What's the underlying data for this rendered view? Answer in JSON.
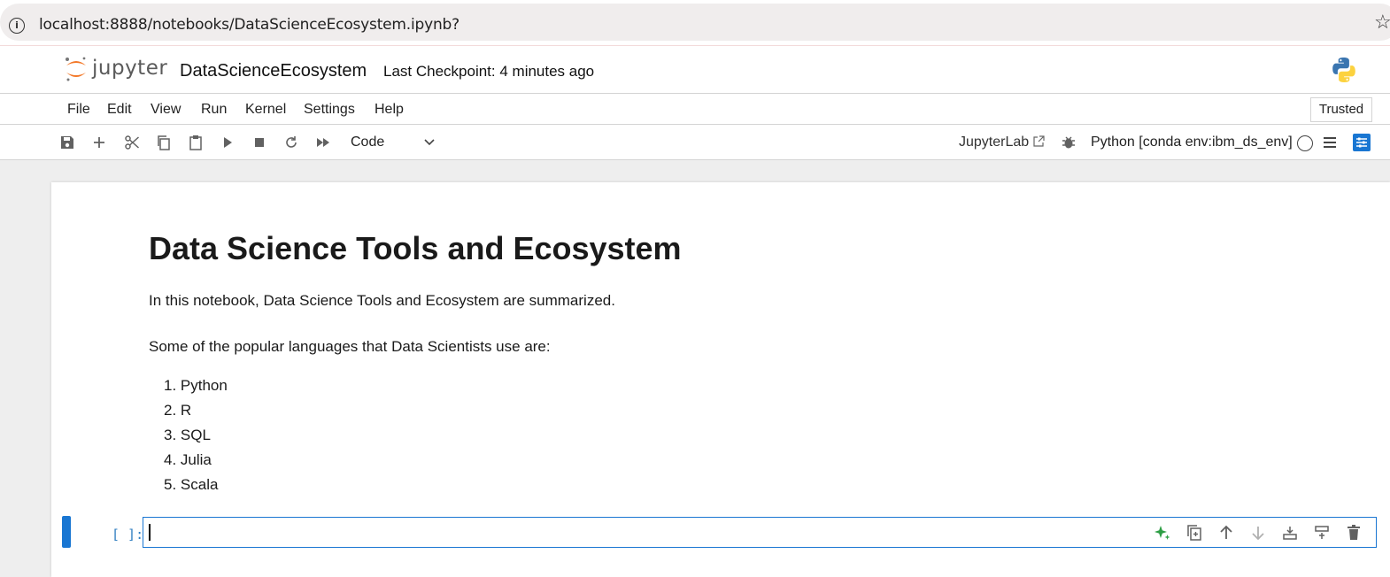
{
  "browser": {
    "url": "localhost:8888/notebooks/DataScienceEcosystem.ipynb?"
  },
  "header": {
    "logo_text": "jupyter",
    "notebook_title": "DataScienceEcosystem",
    "checkpoint": "Last Checkpoint: 4 minutes ago"
  },
  "menu": {
    "items": [
      "File",
      "Edit",
      "View",
      "Run",
      "Kernel",
      "Settings",
      "Help"
    ],
    "trusted": "Trusted"
  },
  "toolbar": {
    "cell_type": "Code",
    "jupyterlab_link": "JupyterLab",
    "kernel_name": "Python [conda env:ibm_ds_env]"
  },
  "notebook": {
    "heading": "Data Science Tools and Ecosystem",
    "intro": "In this notebook, Data Science Tools and Ecosystem are summarized.",
    "languages_intro": "Some of the popular languages that Data Scientists use are:",
    "languages": [
      "1. Python",
      "2. R",
      "3. SQL",
      "4. Julia",
      "5. Scala"
    ],
    "code_prompt": "[ ]:"
  },
  "colors": {
    "accent": "#1976d2",
    "prompt": "#307fc1",
    "jupyter_orange": "#f37726",
    "ai_green": "#2e9e45"
  }
}
